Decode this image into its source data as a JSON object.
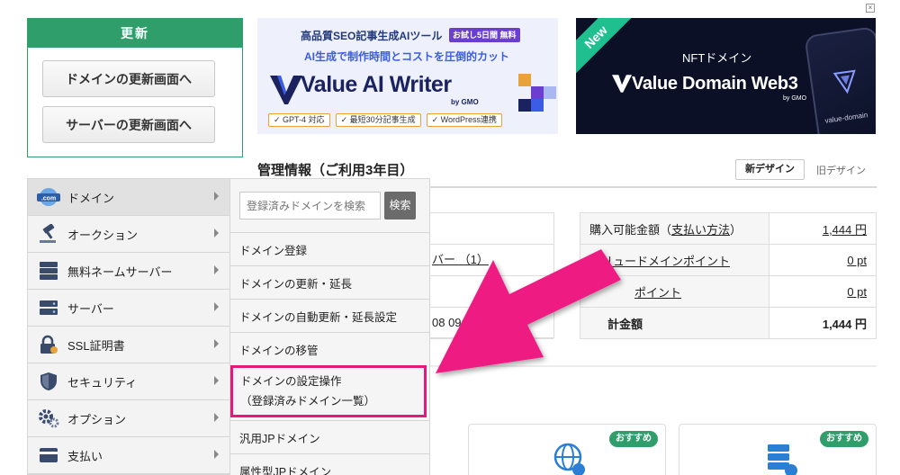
{
  "renew": {
    "heading": "更新",
    "domain_button": "ドメインの更新画面へ",
    "server_button": "サーバーの更新画面へ"
  },
  "banner_ai": {
    "top_text": "高品質SEO記事生成AIツール",
    "badge": "お試し5日間 無料",
    "sub_text": "AI生成で制作時間とコストを圧倒的カット",
    "title": "Value AI Writer",
    "by": "by GMO",
    "tags": [
      "✓ GPT-4 対応",
      "✓ 最短30分記事生成",
      "✓ WordPress連携"
    ]
  },
  "banner_web3": {
    "new_label": "New",
    "nft_text": "NFTドメイン",
    "title": "Value Domain Web3",
    "by": "by GMO",
    "phone_text": "value-domain"
  },
  "close_label": "×",
  "header": {
    "title": "管理情報（ご利用3年目）",
    "new_design": "新デザイン",
    "old_design": "旧デザイン"
  },
  "bg_left": {
    "row2": "バー （1）",
    "row4": "08 09:00"
  },
  "info": {
    "rows": [
      {
        "label": "購入可能金額（",
        "link": "支払い方法",
        "label_end": "）",
        "value": "1,444 円"
      },
      {
        "label": "",
        "link": "バリュードメインポイント",
        "label_end": "",
        "value": "0 pt"
      },
      {
        "label": "",
        "link": "ポイント",
        "label_end": "",
        "value": "0 pt"
      },
      {
        "label": "計金額",
        "link": "",
        "label_end": "",
        "value": "1,444 円"
      }
    ]
  },
  "cards": {
    "badge": "おすすめ"
  },
  "menu": {
    "items": [
      {
        "label": "ドメイン",
        "icon": "dotcom-icon"
      },
      {
        "label": "オークション",
        "icon": "gavel-icon"
      },
      {
        "label": "無料ネームサーバー",
        "icon": "server-stack-icon"
      },
      {
        "label": "サーバー",
        "icon": "server-icon"
      },
      {
        "label": "SSL証明書",
        "icon": "lock-icon"
      },
      {
        "label": "セキュリティ",
        "icon": "shield-icon"
      },
      {
        "label": "オプション",
        "icon": "gears-icon"
      },
      {
        "label": "支払い",
        "icon": "card-icon"
      }
    ]
  },
  "submenu": {
    "search_placeholder": "登録済みドメインを検索",
    "search_button": "検索",
    "items": [
      "ドメイン登録",
      "ドメインの更新・延長",
      "ドメインの自動更新・延長設定",
      "ドメインの移管",
      "ドメインの設定操作",
      "（登録済みドメイン一覧）",
      "汎用JPドメイン",
      "属性型JPドメイン"
    ]
  },
  "colors": {
    "accent_green": "#2f9e6b",
    "highlight_pink": "#e5197c"
  }
}
